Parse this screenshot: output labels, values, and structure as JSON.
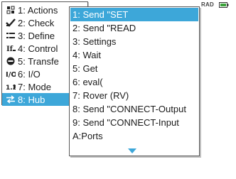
{
  "status": {
    "mode": "RAD",
    "battery_icon": "battery-charging-icon"
  },
  "main_menu": {
    "items": [
      {
        "label": "1: Actions",
        "icon": "actions-icon"
      },
      {
        "label": "2: Check",
        "icon": "check-icon"
      },
      {
        "label": "3: Define",
        "icon": "define-icon"
      },
      {
        "label": "4: Control",
        "icon": "control-icon"
      },
      {
        "label": "5: Transfe",
        "icon": "transfer-icon"
      },
      {
        "label": "6: I/O",
        "icon": "io-icon"
      },
      {
        "label": "7: Mode",
        "icon": "mode-icon"
      },
      {
        "label": "8: Hub",
        "icon": "hub-icon",
        "selected": true
      }
    ]
  },
  "sub_menu": {
    "items": [
      {
        "label": "1: Send \"SET",
        "selected": true
      },
      {
        "label": "2: Send \"READ"
      },
      {
        "label": "3: Settings"
      },
      {
        "label": "4: Wait"
      },
      {
        "label": "5: Get"
      },
      {
        "label": "6: eval("
      },
      {
        "label": "7: Rover (RV)"
      },
      {
        "label": "8: Send \"CONNECT-Output"
      },
      {
        "label": "9: Send \"CONNECT-Input"
      },
      {
        "label": "A:Ports"
      }
    ],
    "more_indicator": "scroll-down-icon"
  },
  "colors": {
    "selection": "#3da7d9",
    "border": "#5a5a5a",
    "text": "#1a1a1a"
  }
}
